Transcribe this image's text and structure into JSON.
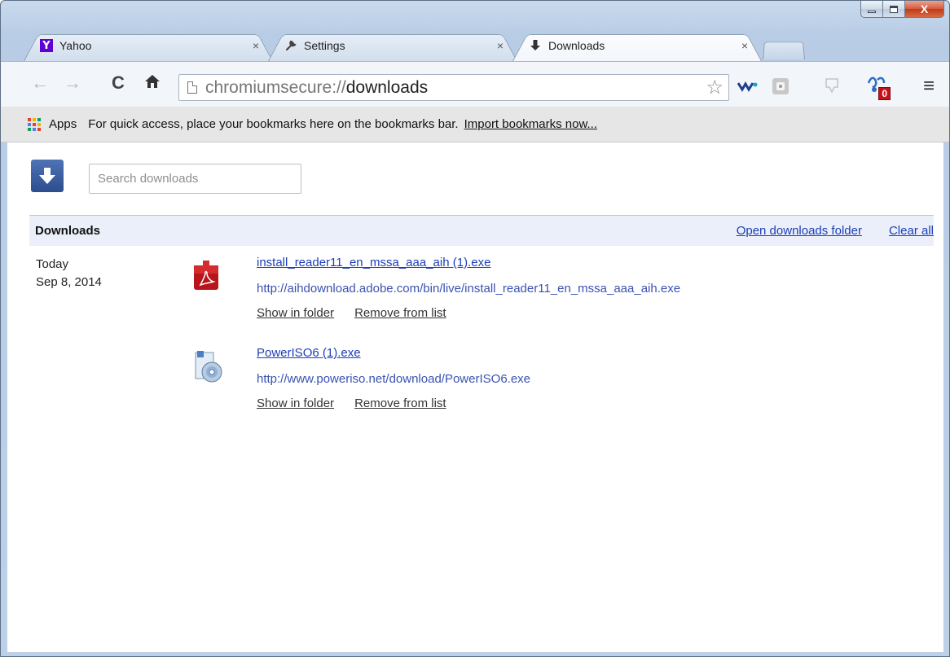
{
  "window": {
    "close_glyph": "X"
  },
  "tabs": [
    {
      "title": "Yahoo",
      "icon": "yahoo-icon",
      "icon_glyph": "Y",
      "close": "×",
      "active": false
    },
    {
      "title": "Settings",
      "icon": "wrench-icon",
      "close": "×",
      "active": false
    },
    {
      "title": "Downloads",
      "icon": "download-arrow-icon",
      "close": "×",
      "active": true
    }
  ],
  "toolbar": {
    "back_glyph": "←",
    "forward_glyph": "→",
    "reload_glyph": "C",
    "home_glyph": "⌂",
    "address_scheme": "chromiumsecure://",
    "address_path": "downloads",
    "star_glyph": "☆",
    "badge_count": "0",
    "menu_glyph": "≡"
  },
  "bookmarks_bar": {
    "apps_label": "Apps",
    "hint": "For quick access, place your bookmarks here on the bookmarks bar.",
    "import_link": "Import bookmarks now..."
  },
  "downloads_page": {
    "search_placeholder": "Search downloads",
    "section_title": "Downloads",
    "open_folder_link": "Open downloads folder",
    "clear_all_link": "Clear all",
    "date_day": "Today",
    "date_full": "Sep 8, 2014",
    "items": [
      {
        "file_name": "install_reader11_en_mssa_aaa_aih (1).exe",
        "url": "http://aihdownload.adobe.com/bin/live/install_reader11_en_mssa_aaa_aih.exe",
        "show_in_folder": "Show in folder",
        "remove_from_list": "Remove from list",
        "icon": "adobe-reader-installer-icon"
      },
      {
        "file_name": "PowerISO6 (1).exe",
        "url": "http://www.poweriso.net/download/PowerISO6.exe",
        "show_in_folder": "Show in folder",
        "remove_from_list": "Remove from list",
        "icon": "poweriso-installer-icon"
      }
    ]
  },
  "colors": {
    "link_blue": "#1c3eb8",
    "header_bg": "#ebeff9",
    "bookmarks_bar_bg": "#e6e6e6"
  }
}
